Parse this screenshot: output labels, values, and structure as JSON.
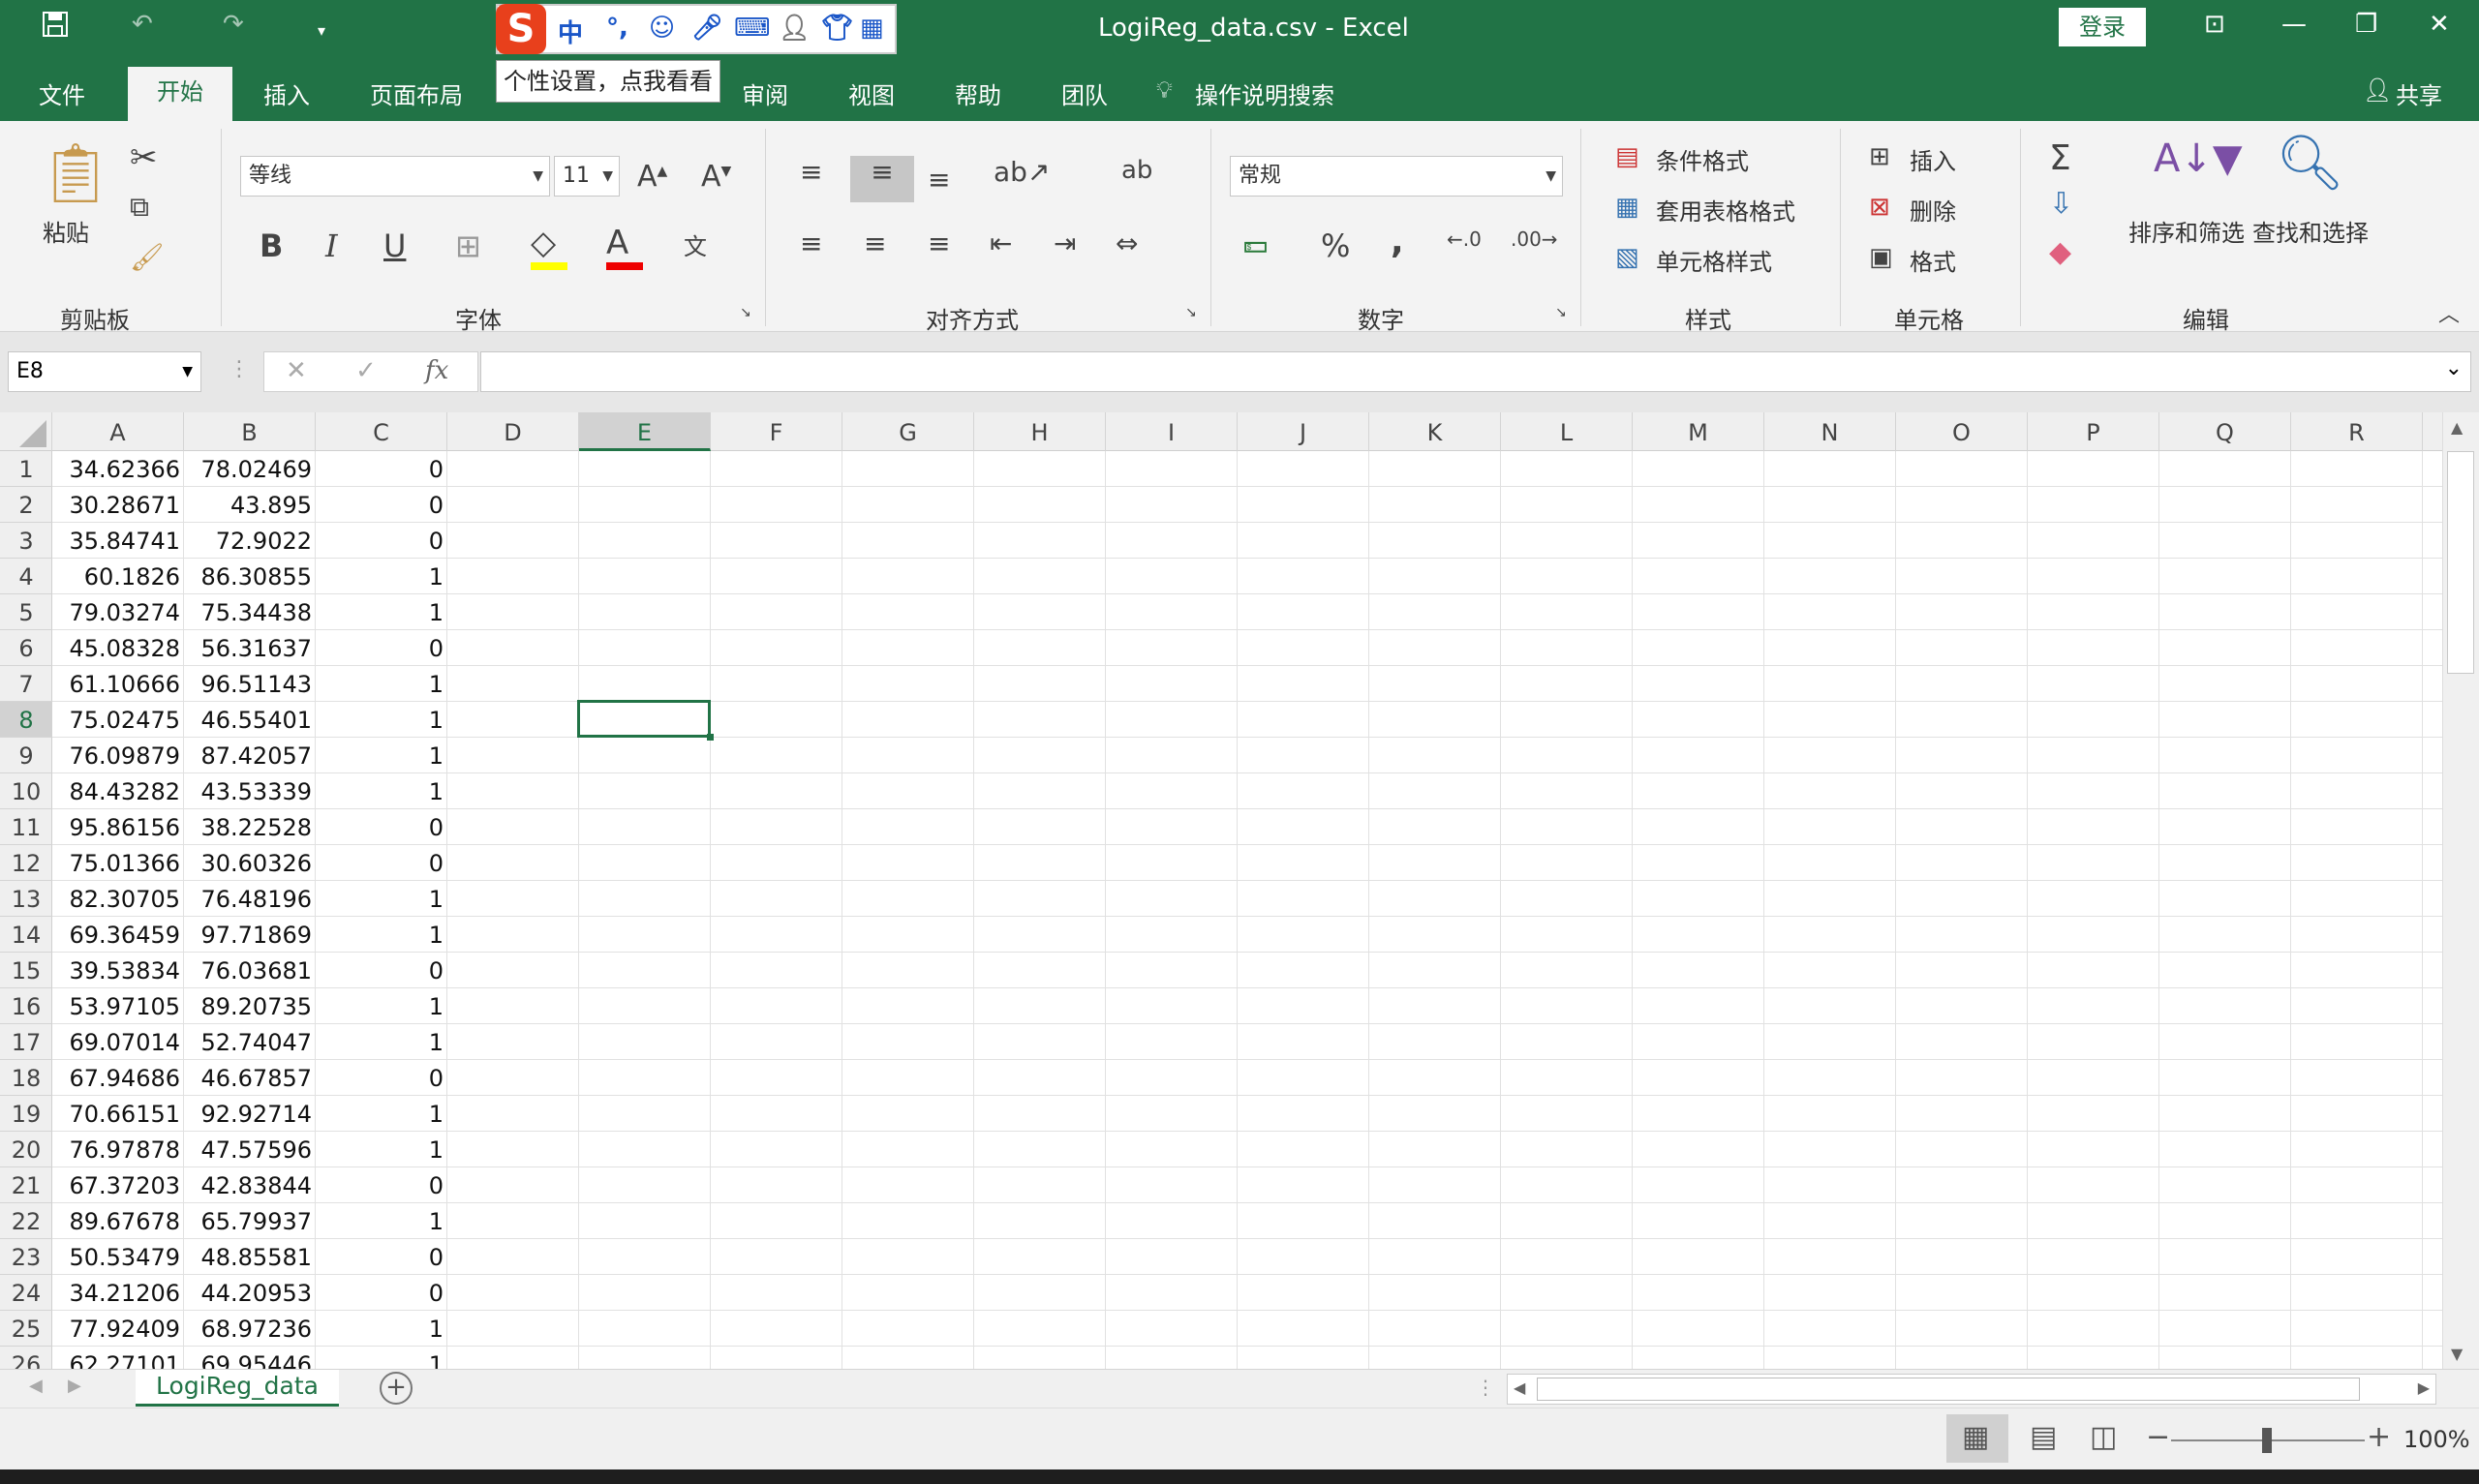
{
  "window": {
    "title": "LogiReg_data.csv  -  Excel",
    "login_label": "登录",
    "share_label": "共享"
  },
  "ime": {
    "tooltip": "个性设置，点我看看",
    "mode_char": "中",
    "punct_char": "°,"
  },
  "tabs": {
    "file": "文件",
    "home": "开始",
    "insert": "插入",
    "page_layout": "页面布局",
    "review": "审阅",
    "view": "视图",
    "help": "帮助",
    "team": "团队",
    "tell_me": "操作说明搜索"
  },
  "ribbon": {
    "clipboard": {
      "paste": "粘贴",
      "group": "剪贴板"
    },
    "font": {
      "name": "等线",
      "size": "11",
      "bold": "B",
      "italic": "I",
      "underline": "U",
      "group": "字体"
    },
    "alignment": {
      "group": "对齐方式"
    },
    "number": {
      "format": "常规",
      "percent": "%",
      "comma": ",",
      "group": "数字"
    },
    "styles": {
      "conditional": "条件格式",
      "table": "套用表格格式",
      "cell": "单元格样式",
      "group": "样式"
    },
    "cells": {
      "insert": "插入",
      "delete": "删除",
      "format": "格式",
      "group": "单元格"
    },
    "editing": {
      "sort": "排序和筛选",
      "find": "查找和选择",
      "group": "编辑"
    }
  },
  "formula_bar": {
    "name_box": "E8",
    "fx": "fx",
    "content": ""
  },
  "sheet": {
    "columns": [
      "A",
      "B",
      "C",
      "D",
      "E",
      "F",
      "G",
      "H",
      "I",
      "J",
      "K",
      "L",
      "M",
      "N",
      "O",
      "P",
      "Q",
      "R"
    ],
    "selected_column": "E",
    "selected_row": 8,
    "rows": [
      {
        "n": "1",
        "a": "34.62366",
        "b": "78.02469",
        "c": "0"
      },
      {
        "n": "2",
        "a": "30.28671",
        "b": "43.895",
        "c": "0"
      },
      {
        "n": "3",
        "a": "35.84741",
        "b": "72.9022",
        "c": "0"
      },
      {
        "n": "4",
        "a": "60.1826",
        "b": "86.30855",
        "c": "1"
      },
      {
        "n": "5",
        "a": "79.03274",
        "b": "75.34438",
        "c": "1"
      },
      {
        "n": "6",
        "a": "45.08328",
        "b": "56.31637",
        "c": "0"
      },
      {
        "n": "7",
        "a": "61.10666",
        "b": "96.51143",
        "c": "1"
      },
      {
        "n": "8",
        "a": "75.02475",
        "b": "46.55401",
        "c": "1"
      },
      {
        "n": "9",
        "a": "76.09879",
        "b": "87.42057",
        "c": "1"
      },
      {
        "n": "10",
        "a": "84.43282",
        "b": "43.53339",
        "c": "1"
      },
      {
        "n": "11",
        "a": "95.86156",
        "b": "38.22528",
        "c": "0"
      },
      {
        "n": "12",
        "a": "75.01366",
        "b": "30.60326",
        "c": "0"
      },
      {
        "n": "13",
        "a": "82.30705",
        "b": "76.48196",
        "c": "1"
      },
      {
        "n": "14",
        "a": "69.36459",
        "b": "97.71869",
        "c": "1"
      },
      {
        "n": "15",
        "a": "39.53834",
        "b": "76.03681",
        "c": "0"
      },
      {
        "n": "16",
        "a": "53.97105",
        "b": "89.20735",
        "c": "1"
      },
      {
        "n": "17",
        "a": "69.07014",
        "b": "52.74047",
        "c": "1"
      },
      {
        "n": "18",
        "a": "67.94686",
        "b": "46.67857",
        "c": "0"
      },
      {
        "n": "19",
        "a": "70.66151",
        "b": "92.92714",
        "c": "1"
      },
      {
        "n": "20",
        "a": "76.97878",
        "b": "47.57596",
        "c": "1"
      },
      {
        "n": "21",
        "a": "67.37203",
        "b": "42.83844",
        "c": "0"
      },
      {
        "n": "22",
        "a": "89.67678",
        "b": "65.79937",
        "c": "1"
      },
      {
        "n": "23",
        "a": "50.53479",
        "b": "48.85581",
        "c": "0"
      },
      {
        "n": "24",
        "a": "34.21206",
        "b": "44.20953",
        "c": "0"
      },
      {
        "n": "25",
        "a": "77.92409",
        "b": "68.97236",
        "c": "1"
      },
      {
        "n": "26",
        "a": "62.27101",
        "b": "69.95446",
        "c": "1"
      }
    ],
    "tab_name": "LogiReg_data"
  },
  "status": {
    "zoom": "100%"
  },
  "colors": {
    "accent": "#217346"
  }
}
